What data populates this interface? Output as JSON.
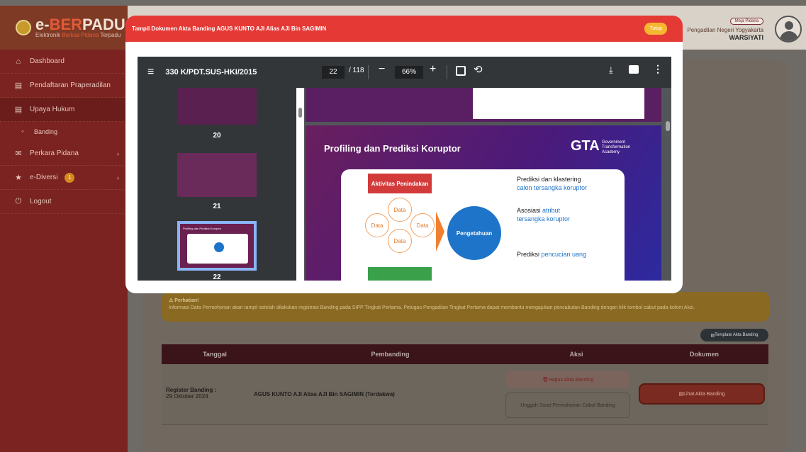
{
  "app": {
    "logo_title_a": "e-",
    "logo_title_b": "BER",
    "logo_title_c": "PADU",
    "logo_sub_a": "Elektronik ",
    "logo_sub_b": "Berkas Pidana",
    "logo_sub_c": " Terpadu"
  },
  "user": {
    "role_badge": "Meja Pidana",
    "court": "Pengadilan Negeri Yogyakarta",
    "name": "WARSIYATI"
  },
  "sidebar": {
    "items": [
      {
        "label": "Dashboard",
        "icon": "home-icon"
      },
      {
        "label": "Pendaftaran Praperadilan",
        "icon": "document-icon"
      },
      {
        "label": "Upaya Hukum",
        "icon": "document-icon"
      },
      {
        "label": "Banding",
        "icon": "circle-icon"
      },
      {
        "label": "Perkara Pidana",
        "icon": "mail-icon"
      },
      {
        "label": "e-Diversi",
        "icon": "star-icon",
        "count": "1"
      },
      {
        "label": "Logout",
        "icon": "power-icon"
      }
    ]
  },
  "modal": {
    "title": "Tampil Dokumen Akta Banding AGUS KUNTO AJI Alias AJI Bin SAGIMIN",
    "close_label": "Tutup"
  },
  "pdf": {
    "doc_title": "330 K/PDT.SUS-HKI/2015",
    "current_page": "22",
    "total_pages": "/ 118",
    "zoom": "66%",
    "thumb_labels": [
      "20",
      "21",
      "22"
    ],
    "thumb_slide_title": "Profiling dan Prediksi Koruptor",
    "slide": {
      "title": "Profiling dan Prediksi Koruptor",
      "logo": "GTA",
      "logo_sub": "Government Transformation Academy",
      "left_box": "Aktivitas Penindakan",
      "data_label": "Data",
      "center": "Pengetahuan",
      "out1_a": "Prediksi dan klastering",
      "out1_b": "calon tersangka koruptor",
      "out2_a": "Asosiasi ",
      "out2_b": "atribut",
      "out2_c": "tersangka koruptor",
      "out3_a": "Prediksi ",
      "out3_b": "pencucian uang"
    }
  },
  "notice": {
    "title": "Perhatian!",
    "text": "Informasi Data Permohonan akan tampil setelah dilakukan registrasi Banding pada SIPP Tingkat Pertama. Petugas Pengadilan Tingkat Pertama dapat membantu mengajukan pencabutan Banding dengan klik tombol cabut pada kolom Aksi."
  },
  "template_button": "Template Akta Banding",
  "table": {
    "headers": [
      "Tanggal",
      "Pembanding",
      "Aksi",
      "Dokumen"
    ],
    "row": {
      "reg_label": "Register Banding :",
      "reg_date": "29 Oktober 2024",
      "pembanding": "AGUS KUNTO AJI Alias AJI Bin SAGIMIN (Terdakwa)",
      "hapus": "Hapus Akta Banding",
      "unggah": "Unggah Surat Permohonan Cabut Banding",
      "lihat": "Lihat Akta Banding"
    }
  }
}
